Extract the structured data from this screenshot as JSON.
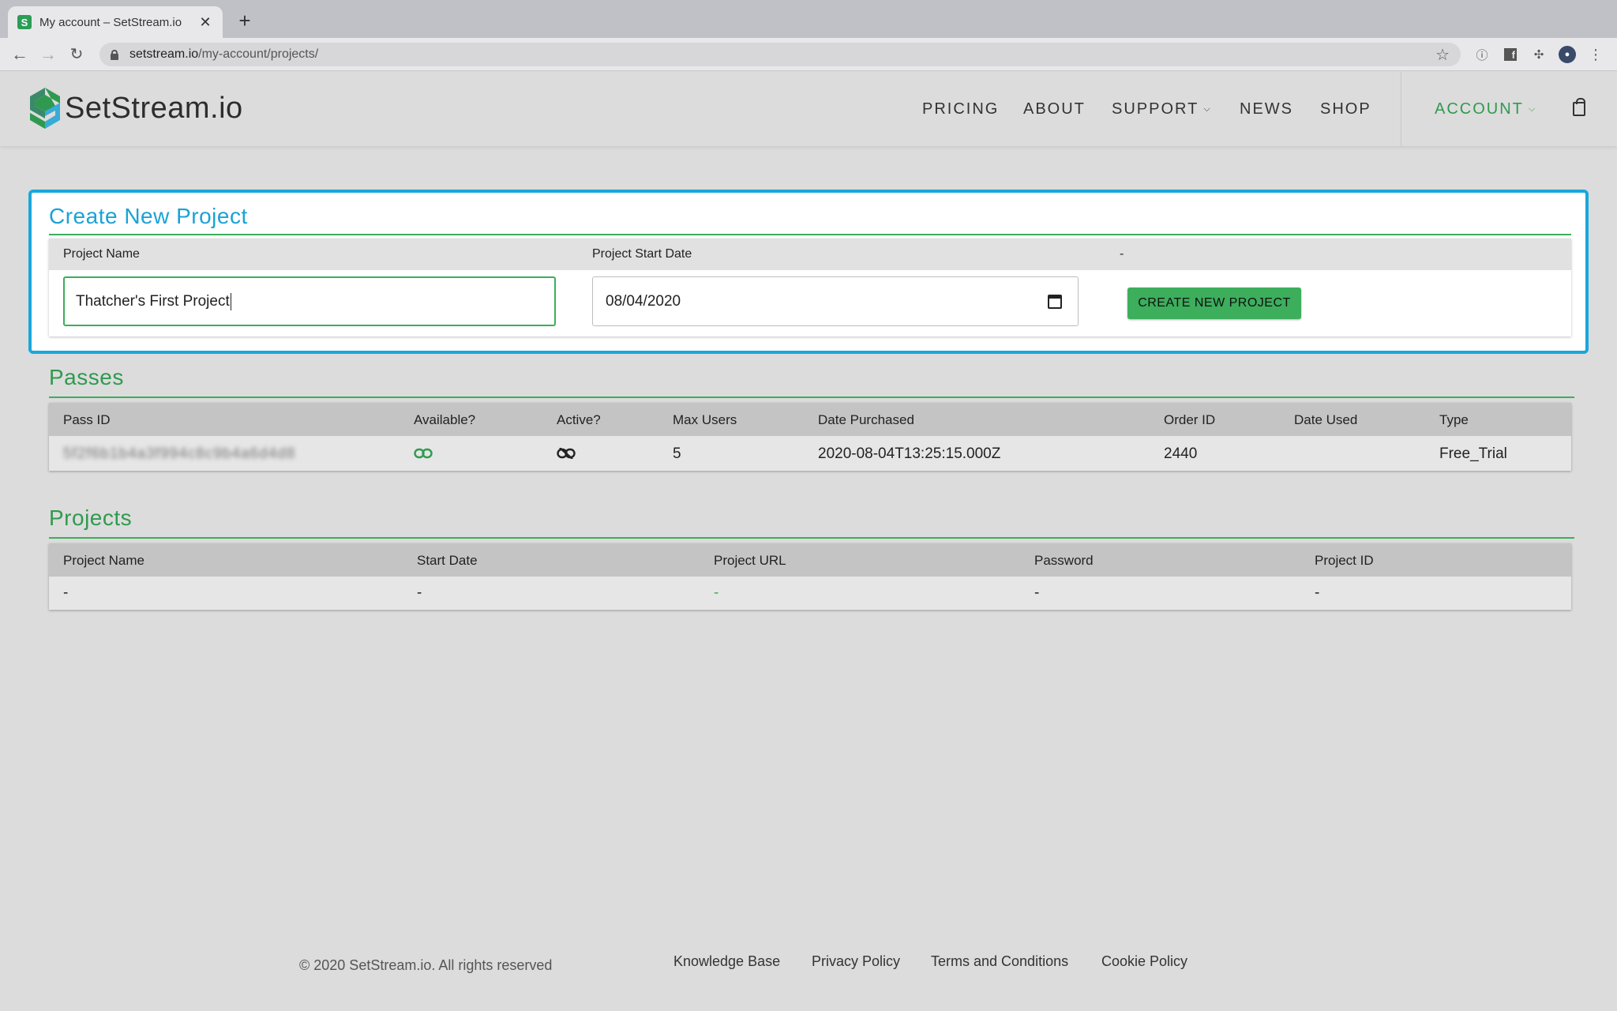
{
  "browser": {
    "tab_title": "My account – SetStream.io",
    "favicon_letter": "S",
    "url_host": "setstream.io",
    "url_path": "/my-account/projects/"
  },
  "site": {
    "brand": "SetStream.io",
    "brand_colors": {
      "green": "#2f9a4f",
      "teal": "#1aa3d5",
      "dark": "#3a8a6a"
    },
    "nav": {
      "pricing": "PRICING",
      "about": "ABOUT",
      "support": "SUPPORT",
      "news": "NEWS",
      "shop": "SHOP",
      "account": "ACCOUNT"
    }
  },
  "create_project": {
    "title": "Create New Project",
    "col_name": "Project Name",
    "col_date": "Project Start Date",
    "col_action": "-",
    "name_value": "Thatcher's First Project",
    "date_value": "08/04/2020",
    "button_label": "CREATE NEW PROJECT"
  },
  "passes": {
    "title": "Passes",
    "headers": [
      "Pass ID",
      "Available?",
      "Active?",
      "Max Users",
      "Date Purchased",
      "Order ID",
      "Date Used",
      "Type"
    ],
    "rows": [
      {
        "pass_id": "5f2f6b1b4a3f994c8c9b4a6d4d8",
        "available_icon": "link-icon",
        "active_icon": "link-off-icon",
        "max_users": "5",
        "date_purchased": "2020-08-04T13:25:15.000Z",
        "order_id": "2440",
        "date_used": "",
        "type": "Free_Trial"
      }
    ]
  },
  "projects": {
    "title": "Projects",
    "headers": [
      "Project Name",
      "Start Date",
      "Project URL",
      "Password",
      "Project ID"
    ],
    "rows": [
      {
        "name": "-",
        "start_date": "-",
        "url": "-",
        "password": "-",
        "project_id": "-"
      }
    ]
  },
  "footer": {
    "copyright": "© 2020 SetStream.io. All rights reserved",
    "links": [
      "Knowledge Base",
      "Privacy Policy",
      "Terms and Conditions",
      "Cookie Policy"
    ]
  }
}
